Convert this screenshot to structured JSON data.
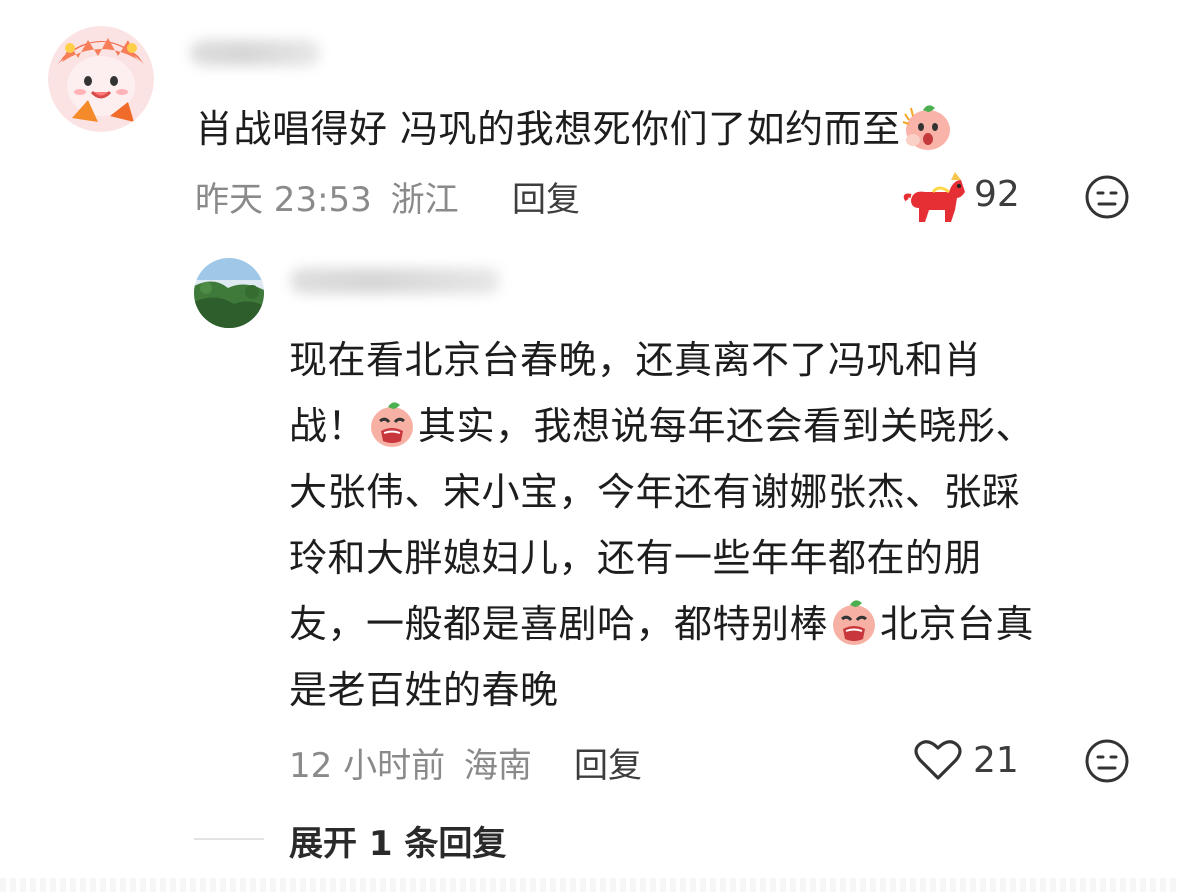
{
  "comments": [
    {
      "text": "肖战唱得好 冯巩的我想死你们了如约而至",
      "time": "昨天 23:53",
      "location": "浙江",
      "reply_label": "回复",
      "likes": "92",
      "like_icon": "red-horse-icon",
      "emoji": "peach-wow-emoji"
    },
    {
      "lines": [
        "现在看北京台春晚，还真离不了冯巩和肖",
        "战！",
        "其实，我想说每年还会看到关晓彤、",
        "大张伟、宋小宝，今年还有谢娜张杰、张踩",
        "玲和大胖媳妇儿，还有一些年年都在的朋",
        "友，一般都是喜剧哈，都特别棒",
        "北京台真",
        "是老百姓的春晚"
      ],
      "time": "12 小时前",
      "location": "海南",
      "reply_label": "回复",
      "likes": "21",
      "like_icon": "heart-outline-icon",
      "emoji": "peach-cry-emoji"
    }
  ],
  "expand_label": "展开 1 条回复",
  "colors": {
    "meta": "#8a8a8a",
    "text": "#1d1d1d",
    "accent_red": "#e8343a"
  }
}
